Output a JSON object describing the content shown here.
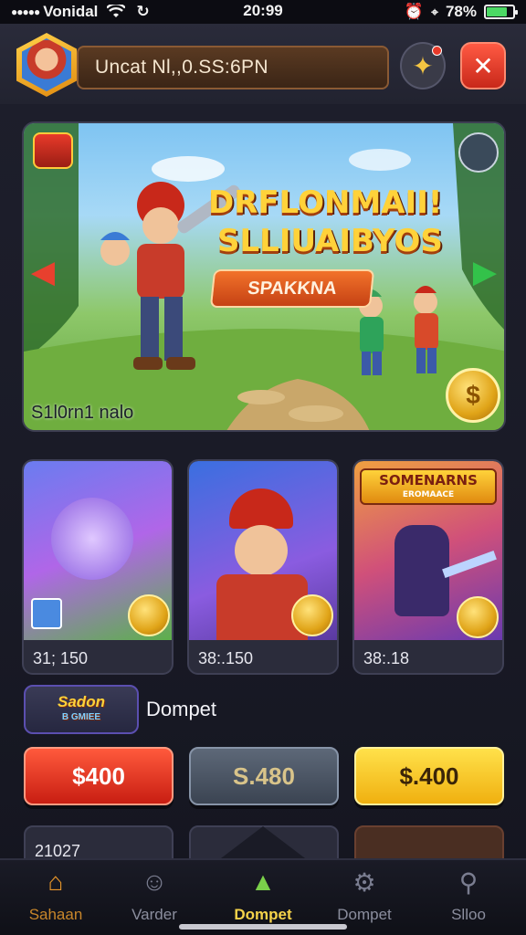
{
  "status_bar": {
    "carrier": "Vonidal",
    "time": "20:99",
    "battery": "78%",
    "battery_level": 0.78
  },
  "header": {
    "title": "Uncat Nl,,0.SS:6PN",
    "puzzle_icon": "puzzle-icon",
    "close_icon": "close-icon"
  },
  "hero": {
    "title_line1": "DRFLONMAII!",
    "title_line2": "SLLIUAIBYOS",
    "cta_label": "SPAKKNA",
    "caption": "S1l0rn1 nalo",
    "coin_symbol": "$"
  },
  "cards": [
    {
      "value": "31; 150"
    },
    {
      "value": "38:.150"
    },
    {
      "value": "38:.18",
      "banner_title": "SOMENARNS",
      "banner_sub": "EROMAACE"
    }
  ],
  "wallet": {
    "logo_title": "Sadon",
    "logo_sub": "B GMIEE",
    "label": "Dompet",
    "amounts": [
      "$400",
      "S.480",
      "$.400"
    ]
  },
  "lower_cards": [
    {
      "value": "21027"
    },
    {
      "value": ""
    },
    {
      "value": ""
    }
  ],
  "nav": {
    "items": [
      {
        "label": "Sahaan",
        "icon": "home-icon"
      },
      {
        "label": "Varder",
        "icon": "vendor-icon"
      },
      {
        "label": "Dompet",
        "icon": "wallet-icon"
      },
      {
        "label": "Dompet",
        "icon": "settings-icon"
      },
      {
        "label": "Slloo",
        "icon": "search-icon"
      }
    ]
  },
  "colors": {
    "accent_gold": "#f5d34a",
    "danger_red": "#e8402e",
    "success_green": "#33c24a"
  }
}
